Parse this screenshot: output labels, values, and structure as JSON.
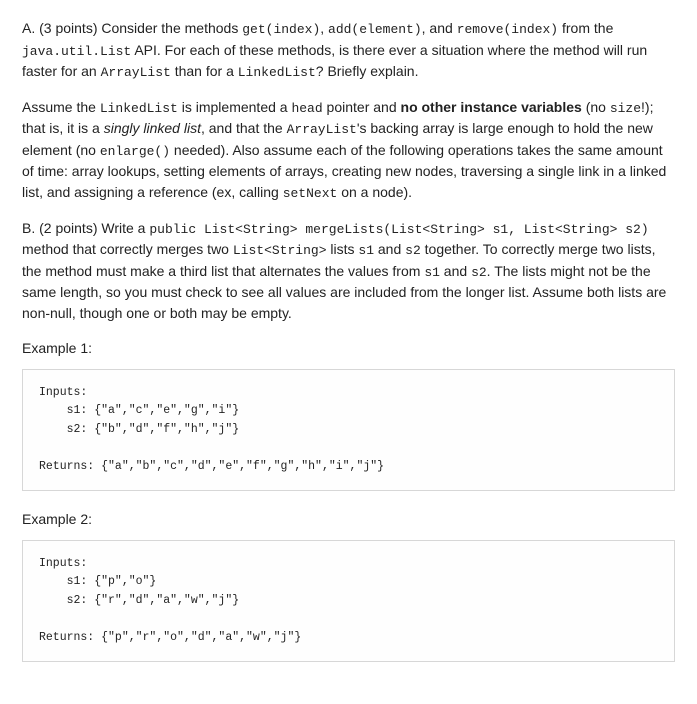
{
  "partA": {
    "text1_pre": "A. (3 points) Consider the methods ",
    "code_get": "get(index)",
    "sep1": ", ",
    "code_add": "add(element)",
    "sep2": ", and ",
    "code_remove": "remove(index)",
    "text1_post": " from the ",
    "code_api": "java.util.List",
    "text2": " API. For each of these methods, is there ever a situation where the method will run faster for an ",
    "code_al": "ArrayList",
    "text3": " than for a ",
    "code_ll": "LinkedList",
    "text4": "? Briefly explain.",
    "assume_pre": "Assume the ",
    "assume_ll": "LinkedList",
    "assume_mid1": " is implemented a ",
    "assume_head": "head",
    "assume_mid2": " pointer and ",
    "assume_bold": "no other instance variables",
    "assume_mid3": " (no ",
    "assume_size": "size",
    "assume_mid4": "!); that is, it is a ",
    "assume_ital": "singly linked list",
    "assume_mid5": ", and that the ",
    "assume_al": "ArrayList",
    "assume_mid6": "'s backing array is large enough to hold the new element (no ",
    "assume_enlarge": "enlarge()",
    "assume_mid7": " needed). Also assume each of the following operations takes the same amount of time: array lookups, setting elements of arrays, creating new nodes, traversing a single link in a linked list, and assigning a reference (ex, calling ",
    "assume_setnext": "setNext",
    "assume_end": " on a node)."
  },
  "partB": {
    "text1": "B. (2 points) Write a ",
    "code_sig": "public List<String> mergeLists(List<String> s1, List<String> s2)",
    "text2": " method that correctly merges two ",
    "code_ls": "List<String>",
    "text3": " lists ",
    "code_s1": "s1",
    "text4": " and ",
    "code_s2": "s2",
    "text5": " together. To correctly merge two lists, the method must make a third list that alternates the values from ",
    "code_s1b": "s1",
    "text6": " and ",
    "code_s2b": "s2",
    "text7": ". The lists might not be the same length, so you must check to see all values are included from the longer list. Assume both lists are non-null, though one or both may be empty."
  },
  "examples": {
    "label1": "Example 1:",
    "block1": "Inputs:\n    s1: {\"a\",\"c\",\"e\",\"g\",\"i\"}\n    s2: {\"b\",\"d\",\"f\",\"h\",\"j\"}\n\nReturns: {\"a\",\"b\",\"c\",\"d\",\"e\",\"f\",\"g\",\"h\",\"i\",\"j\"}",
    "label2": "Example 2:",
    "block2": "Inputs:\n    s1: {\"p\",\"o\"}\n    s2: {\"r\",\"d\",\"a\",\"w\",\"j\"}\n\nReturns: {\"p\",\"r\",\"o\",\"d\",\"a\",\"w\",\"j\"}"
  }
}
